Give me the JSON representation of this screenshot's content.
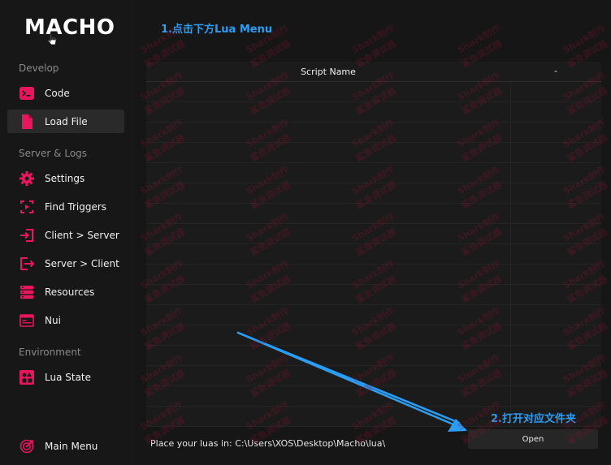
{
  "app": {
    "logo": "MACHO"
  },
  "annotations": {
    "step1": "1.点击下方Lua Menu",
    "step2": "2.打开对应文件夹"
  },
  "sidebar": {
    "sections": {
      "develop": "Develop",
      "server_logs": "Server & Logs",
      "environment": "Environment"
    },
    "items": [
      {
        "label": "Code",
        "icon": "terminal-icon"
      },
      {
        "label": "Load File",
        "icon": "file-icon"
      },
      {
        "label": "Settings",
        "icon": "gear-icon"
      },
      {
        "label": "Find Triggers",
        "icon": "triggers-icon"
      },
      {
        "label": "Client > Server",
        "icon": "login-icon"
      },
      {
        "label": "Server > Client",
        "icon": "logout-icon"
      },
      {
        "label": "Resources",
        "icon": "server-icon"
      },
      {
        "label": "Nui",
        "icon": "window-icon"
      },
      {
        "label": "Lua State",
        "icon": "shapes-icon"
      },
      {
        "label": "Main Menu",
        "icon": "target-icon"
      }
    ],
    "active": "Load File"
  },
  "table": {
    "columns": [
      "Script Name",
      "-"
    ]
  },
  "footer": {
    "path_label": "Place your luas in: C:\\Users\\XOS\\Desktop\\Macho\\lua\\",
    "open_button": "Open"
  },
  "watermark": {
    "text": "Shark制作",
    "text2": "鲨鱼调试器"
  },
  "colors": {
    "accent": "#e8175d",
    "annotation": "#2a9df4",
    "background": "#171717"
  }
}
